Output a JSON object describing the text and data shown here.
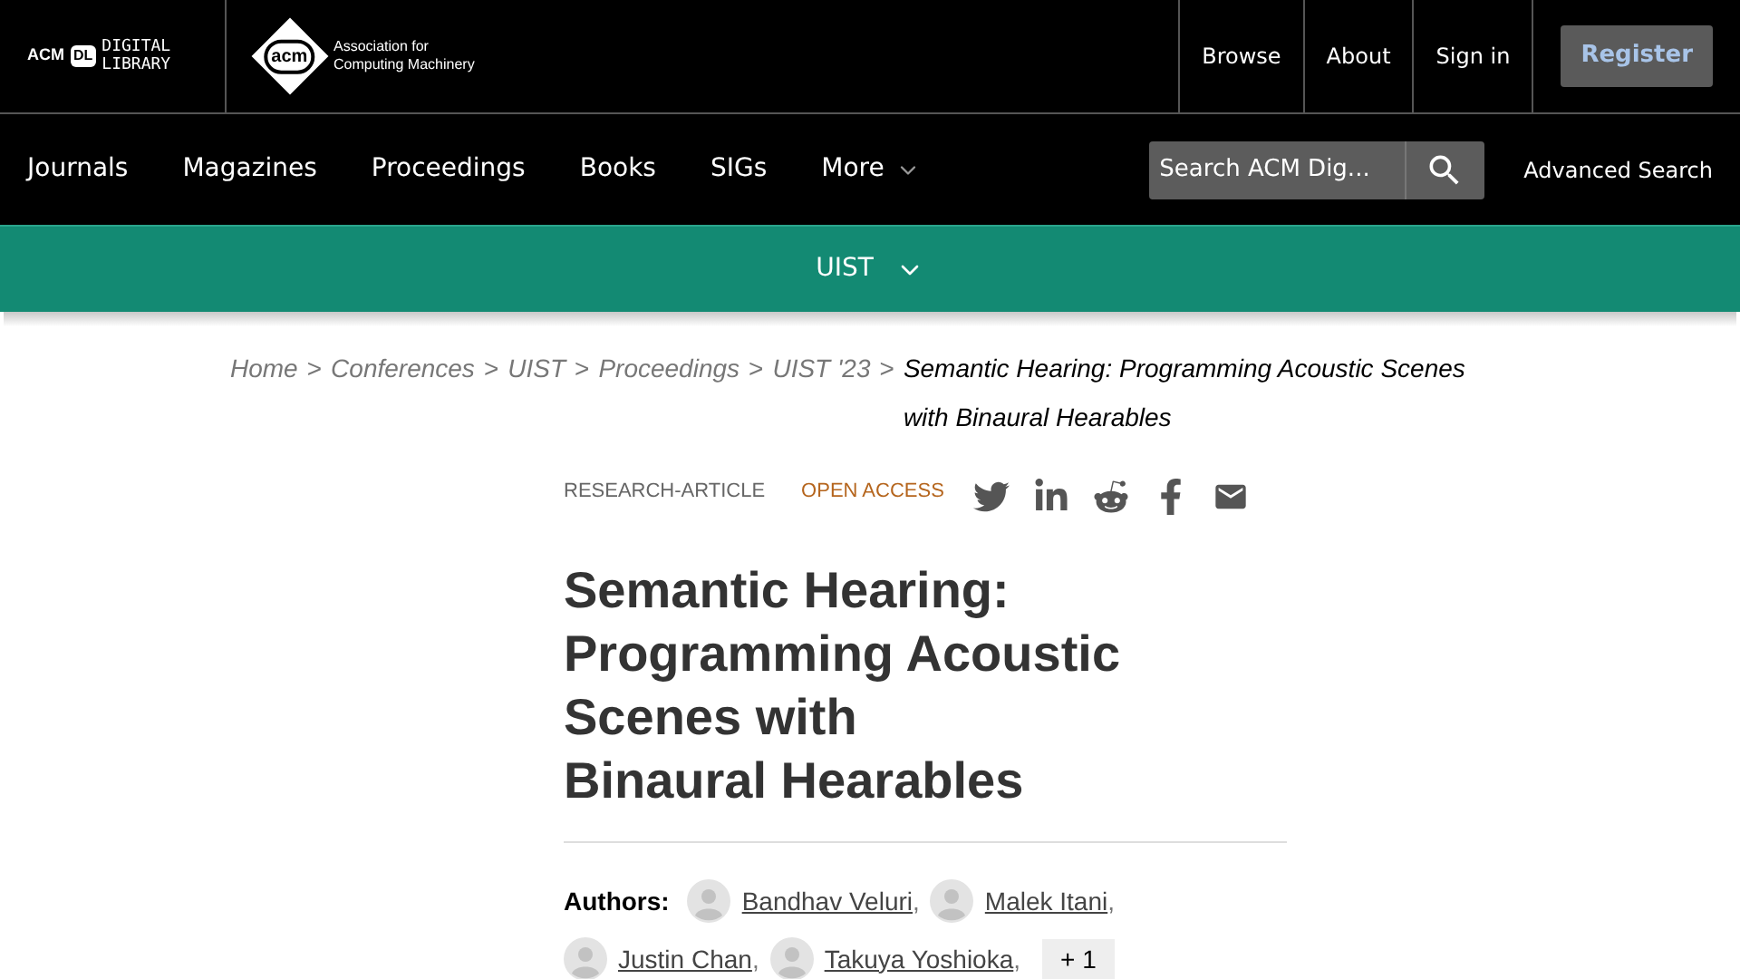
{
  "top_bar": {
    "dl_logo": {
      "acm": "ACM",
      "dl": "DL",
      "line1": "DIGITAL",
      "line2": "LIBRARY"
    },
    "acm_logo": {
      "mark": "acm",
      "line1": "Association for",
      "line2": "Computing Machinery"
    },
    "links": [
      "Browse",
      "About",
      "Sign in"
    ],
    "register": "Register"
  },
  "nav": {
    "items": [
      {
        "label": "Journals",
        "dropdown": false
      },
      {
        "label": "Magazines",
        "dropdown": false
      },
      {
        "label": "Proceedings",
        "dropdown": false
      },
      {
        "label": "Books",
        "dropdown": false
      },
      {
        "label": "SIGs",
        "dropdown": false
      },
      {
        "label": "More",
        "dropdown": true
      }
    ],
    "search": {
      "placeholder": "Search ACM Dig..."
    },
    "advanced": "Advanced Search"
  },
  "conference_bar": {
    "label": "UIST",
    "expanded": false
  },
  "breadcrumb": [
    {
      "kind": "link",
      "text": "Home"
    },
    {
      "kind": "separator",
      "text": ">"
    },
    {
      "kind": "link",
      "text": "Conferences"
    },
    {
      "kind": "separator",
      "text": ">"
    },
    {
      "kind": "link",
      "text": "UIST"
    },
    {
      "kind": "separator",
      "text": ">"
    },
    {
      "kind": "link",
      "text": "Proceedings"
    },
    {
      "kind": "separator",
      "text": ">"
    },
    {
      "kind": "link",
      "text": "UIST '23"
    },
    {
      "kind": "separator",
      "text": ">"
    },
    {
      "kind": "current",
      "text": "Semantic Hearing: Programming Acoustic Scenes with Binaural Hearables"
    }
  ],
  "article": {
    "type": "RESEARCH-ARTICLE",
    "access": "OPEN ACCESS",
    "share": [
      {
        "kind": "twitter"
      },
      {
        "kind": "linkedin"
      },
      {
        "kind": "reddit"
      },
      {
        "kind": "facebook"
      },
      {
        "kind": "email"
      }
    ],
    "title_lines": [
      "Semantic Hearing:",
      "Programming Acoustic",
      "Scenes with",
      "Binaural Hearables"
    ],
    "authors_label": "Authors:",
    "authors": [
      {
        "name": "Bandhav Veluri",
        "suffix": ","
      },
      {
        "name": "Malek Itani",
        "suffix": ","
      },
      {
        "name": "Justin Chan",
        "suffix": ","
      },
      {
        "name": "Takuya Yoshioka",
        "suffix": ","
      }
    ],
    "more_authors": "+ 1"
  }
}
